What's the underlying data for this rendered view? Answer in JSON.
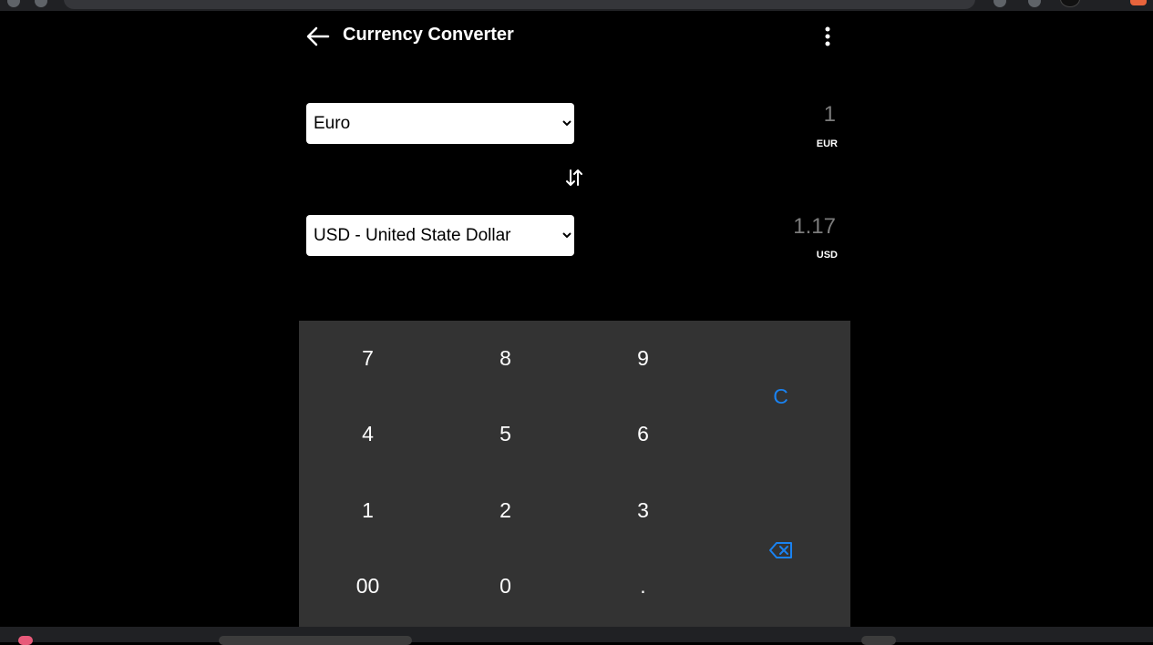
{
  "header": {
    "title": "Currency Converter",
    "back_icon": "arrow-left-icon",
    "menu_icon": "more-vertical-icon"
  },
  "converter": {
    "from": {
      "selected": "Euro",
      "options": [
        "Euro"
      ],
      "amount": "1",
      "code": "EUR"
    },
    "swap_icon": "swap-vertical-icon",
    "to": {
      "selected": "USD - United State Dollar",
      "options": [
        "USD - United State Dollar"
      ],
      "amount": "1.17",
      "code": "USD"
    }
  },
  "keypad": {
    "keys": [
      "7",
      "8",
      "9",
      "4",
      "5",
      "6",
      "1",
      "2",
      "3",
      "00",
      "0",
      "."
    ],
    "clear_label": "C",
    "backspace_icon": "backspace-icon"
  },
  "colors": {
    "background": "#000000",
    "keypad_background": "#333333",
    "accent": "#1a82f0",
    "amount_text": "#7c7c7c"
  }
}
